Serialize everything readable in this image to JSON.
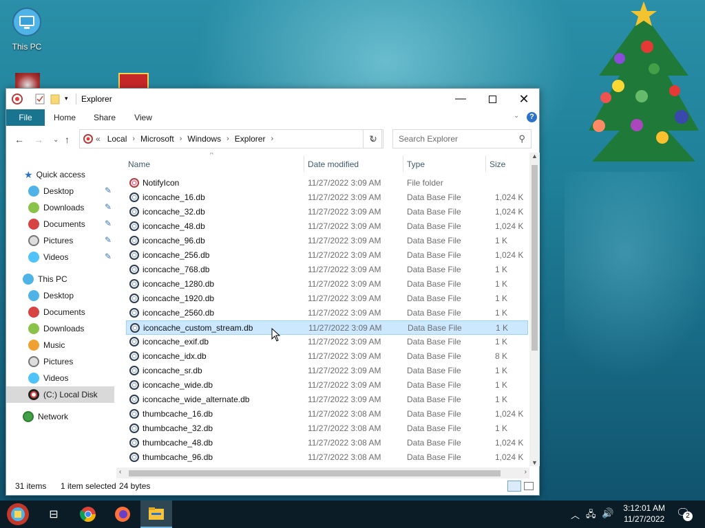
{
  "desktop": {
    "icons": [
      {
        "label": "This PC"
      }
    ]
  },
  "window": {
    "title": "Explorer",
    "ribbon_tabs": [
      "File",
      "Home",
      "Share",
      "View"
    ],
    "address": {
      "overflow": "«",
      "crumbs": [
        "Local",
        "Microsoft",
        "Windows",
        "Explorer"
      ]
    },
    "search_placeholder": "Search Explorer",
    "nav": {
      "quick_access": "Quick access",
      "quick_items": [
        "Desktop",
        "Downloads",
        "Documents",
        "Pictures",
        "Videos"
      ],
      "this_pc": "This PC",
      "pc_items": [
        "Desktop",
        "Documents",
        "Downloads",
        "Music",
        "Pictures",
        "Videos",
        "(C:) Local Disk"
      ],
      "network": "Network"
    },
    "columns": [
      "Name",
      "Date modified",
      "Type",
      "Size"
    ],
    "files": [
      {
        "name": "NotifyIcon",
        "date": "11/27/2022 3:09 AM",
        "type": "File folder",
        "size": ""
      },
      {
        "name": "iconcache_16.db",
        "date": "11/27/2022 3:09 AM",
        "type": "Data Base File",
        "size": "1,024 K"
      },
      {
        "name": "iconcache_32.db",
        "date": "11/27/2022 3:09 AM",
        "type": "Data Base File",
        "size": "1,024 K"
      },
      {
        "name": "iconcache_48.db",
        "date": "11/27/2022 3:09 AM",
        "type": "Data Base File",
        "size": "1,024 K"
      },
      {
        "name": "iconcache_96.db",
        "date": "11/27/2022 3:09 AM",
        "type": "Data Base File",
        "size": "1 K"
      },
      {
        "name": "iconcache_256.db",
        "date": "11/27/2022 3:09 AM",
        "type": "Data Base File",
        "size": "1,024 K"
      },
      {
        "name": "iconcache_768.db",
        "date": "11/27/2022 3:09 AM",
        "type": "Data Base File",
        "size": "1 K"
      },
      {
        "name": "iconcache_1280.db",
        "date": "11/27/2022 3:09 AM",
        "type": "Data Base File",
        "size": "1 K"
      },
      {
        "name": "iconcache_1920.db",
        "date": "11/27/2022 3:09 AM",
        "type": "Data Base File",
        "size": "1 K"
      },
      {
        "name": "iconcache_2560.db",
        "date": "11/27/2022 3:09 AM",
        "type": "Data Base File",
        "size": "1 K"
      },
      {
        "name": "iconcache_custom_stream.db",
        "date": "11/27/2022 3:09 AM",
        "type": "Data Base File",
        "size": "1 K"
      },
      {
        "name": "iconcache_exif.db",
        "date": "11/27/2022 3:09 AM",
        "type": "Data Base File",
        "size": "1 K"
      },
      {
        "name": "iconcache_idx.db",
        "date": "11/27/2022 3:09 AM",
        "type": "Data Base File",
        "size": "8 K"
      },
      {
        "name": "iconcache_sr.db",
        "date": "11/27/2022 3:09 AM",
        "type": "Data Base File",
        "size": "1 K"
      },
      {
        "name": "iconcache_wide.db",
        "date": "11/27/2022 3:09 AM",
        "type": "Data Base File",
        "size": "1 K"
      },
      {
        "name": "iconcache_wide_alternate.db",
        "date": "11/27/2022 3:09 AM",
        "type": "Data Base File",
        "size": "1 K"
      },
      {
        "name": "thumbcache_16.db",
        "date": "11/27/2022 3:08 AM",
        "type": "Data Base File",
        "size": "1,024 K"
      },
      {
        "name": "thumbcache_32.db",
        "date": "11/27/2022 3:08 AM",
        "type": "Data Base File",
        "size": "1 K"
      },
      {
        "name": "thumbcache_48.db",
        "date": "11/27/2022 3:08 AM",
        "type": "Data Base File",
        "size": "1,024 K"
      },
      {
        "name": "thumbcache_96.db",
        "date": "11/27/2022 3:08 AM",
        "type": "Data Base File",
        "size": "1,024 K"
      }
    ],
    "selected_index": 10,
    "status": {
      "items": "31 items",
      "selected": "1 item selected",
      "size": "24 bytes"
    }
  },
  "taskbar": {
    "time": "3:12:01 AM",
    "date": "11/27/2022",
    "notifications": "2"
  }
}
